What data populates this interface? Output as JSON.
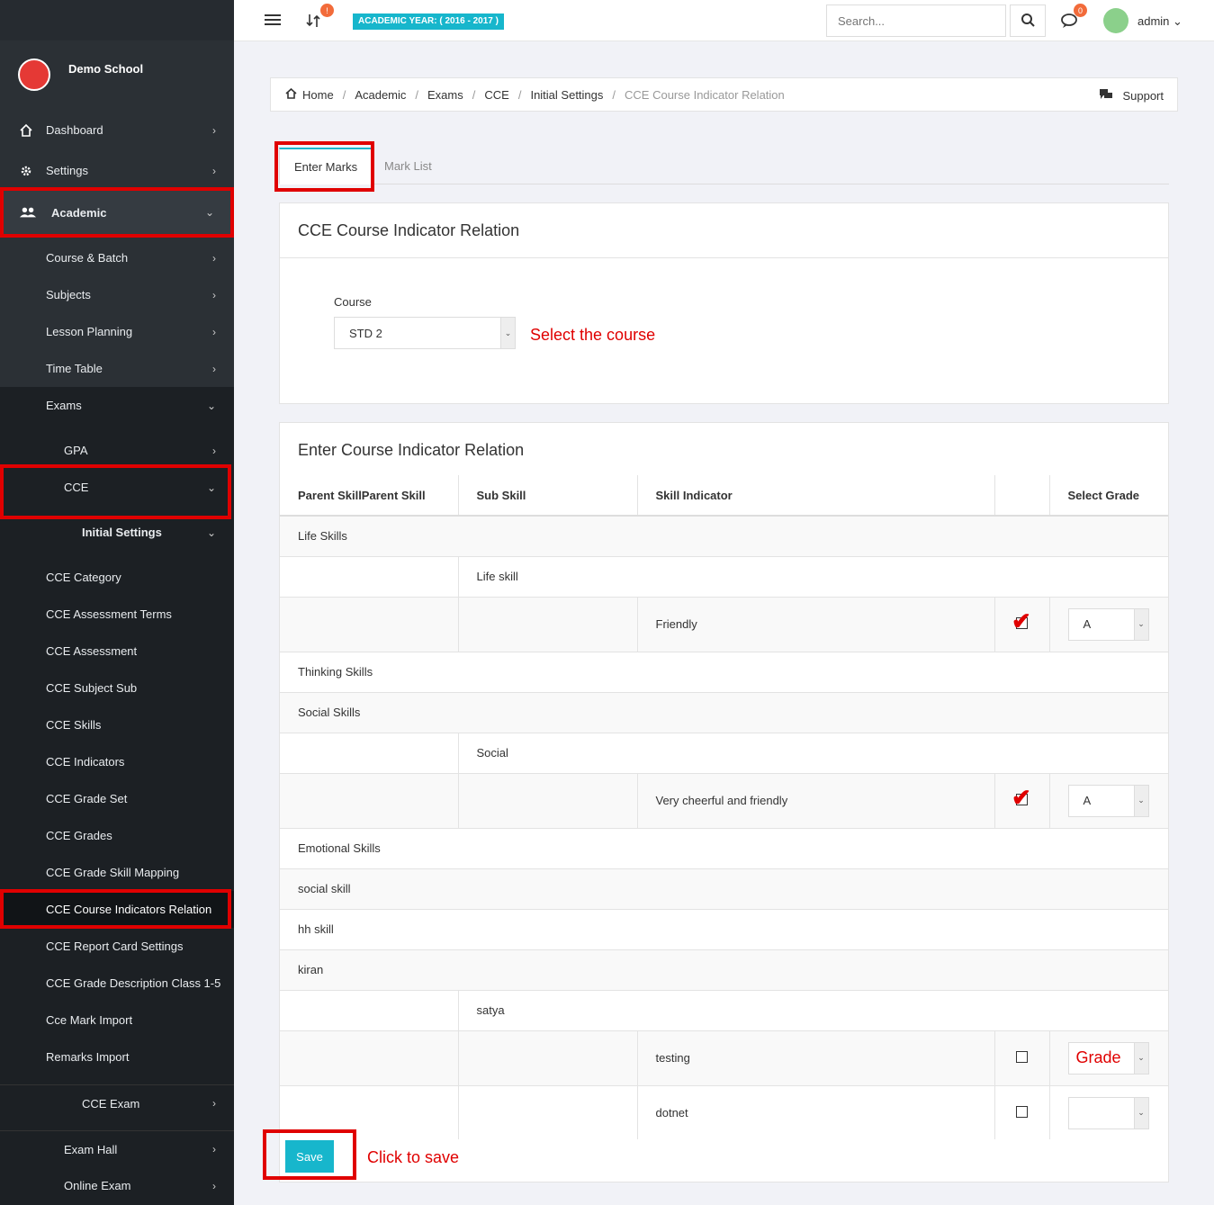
{
  "sidebar": {
    "school_name": "Demo School",
    "items": {
      "dashboard": "Dashboard",
      "settings": "Settings",
      "academic": "Academic",
      "course_batch": "Course & Batch",
      "subjects": "Subjects",
      "lesson_planning": "Lesson Planning",
      "time_table": "Time Table",
      "exams": "Exams",
      "gpa": "GPA",
      "cce": "CCE",
      "initial_settings": "Initial Settings",
      "cce_category": "CCE Category",
      "cce_assessment_terms": "CCE Assessment Terms",
      "cce_assessment": "CCE Assessment",
      "cce_subject_sub": "CCE Subject Sub",
      "cce_skills": "CCE Skills",
      "cce_indicators": "CCE Indicators",
      "cce_grade_set": "CCE Grade Set",
      "cce_grades": "CCE Grades",
      "cce_grade_skill_mapping": "CCE Grade Skill Mapping",
      "cce_course_indicators_relation": "CCE Course Indicators Relation",
      "cce_report_card_settings": "CCE Report Card Settings",
      "cce_grade_description": "CCE Grade Description Class 1-5",
      "cce_mark_import": "Cce Mark Import",
      "remarks_import": "Remarks Import",
      "cce_exam": "CCE Exam",
      "exam_hall": "Exam Hall",
      "online_exam": "Online Exam"
    }
  },
  "topbar": {
    "notif_badge": "!",
    "academic_year": "ACADEMIC YEAR: ( 2016 - 2017 )",
    "search_placeholder": "Search...",
    "chat_badge": "0",
    "user": "admin"
  },
  "breadcrumb": {
    "home": "Home",
    "academic": "Academic",
    "exams": "Exams",
    "cce": "CCE",
    "initial_settings": "Initial Settings",
    "current": "CCE Course Indicator Relation",
    "support": "Support"
  },
  "tabs": {
    "enter_marks": "Enter Marks",
    "mark_list": "Mark List"
  },
  "course_panel": {
    "title": "CCE Course Indicator Relation",
    "course_label": "Course",
    "course_value": "STD 2",
    "annotation": "Select the course"
  },
  "relation_panel": {
    "title": "Enter Course Indicator Relation",
    "headers": {
      "parent": "Parent SkillParent Skill",
      "sub": "Sub Skill",
      "indicator": "Skill Indicator",
      "grade": "Select Grade"
    },
    "rows": {
      "r1": "Life Skills",
      "r2": "Life skill",
      "r3": "Friendly",
      "r3_grade": "A",
      "r4": "Thinking Skills",
      "r5": "Social Skills",
      "r6": "Social",
      "r7": "Very cheerful and friendly",
      "r7_grade": "A",
      "r8": "Emotional Skills",
      "r9": "social skill",
      "r10": "hh skill",
      "r11": "kiran",
      "r12": "satya",
      "r13": "testing",
      "r13_grade": "Grade",
      "r14": "dotnet"
    },
    "save_label": "Save",
    "save_annotation": "Click to save"
  }
}
